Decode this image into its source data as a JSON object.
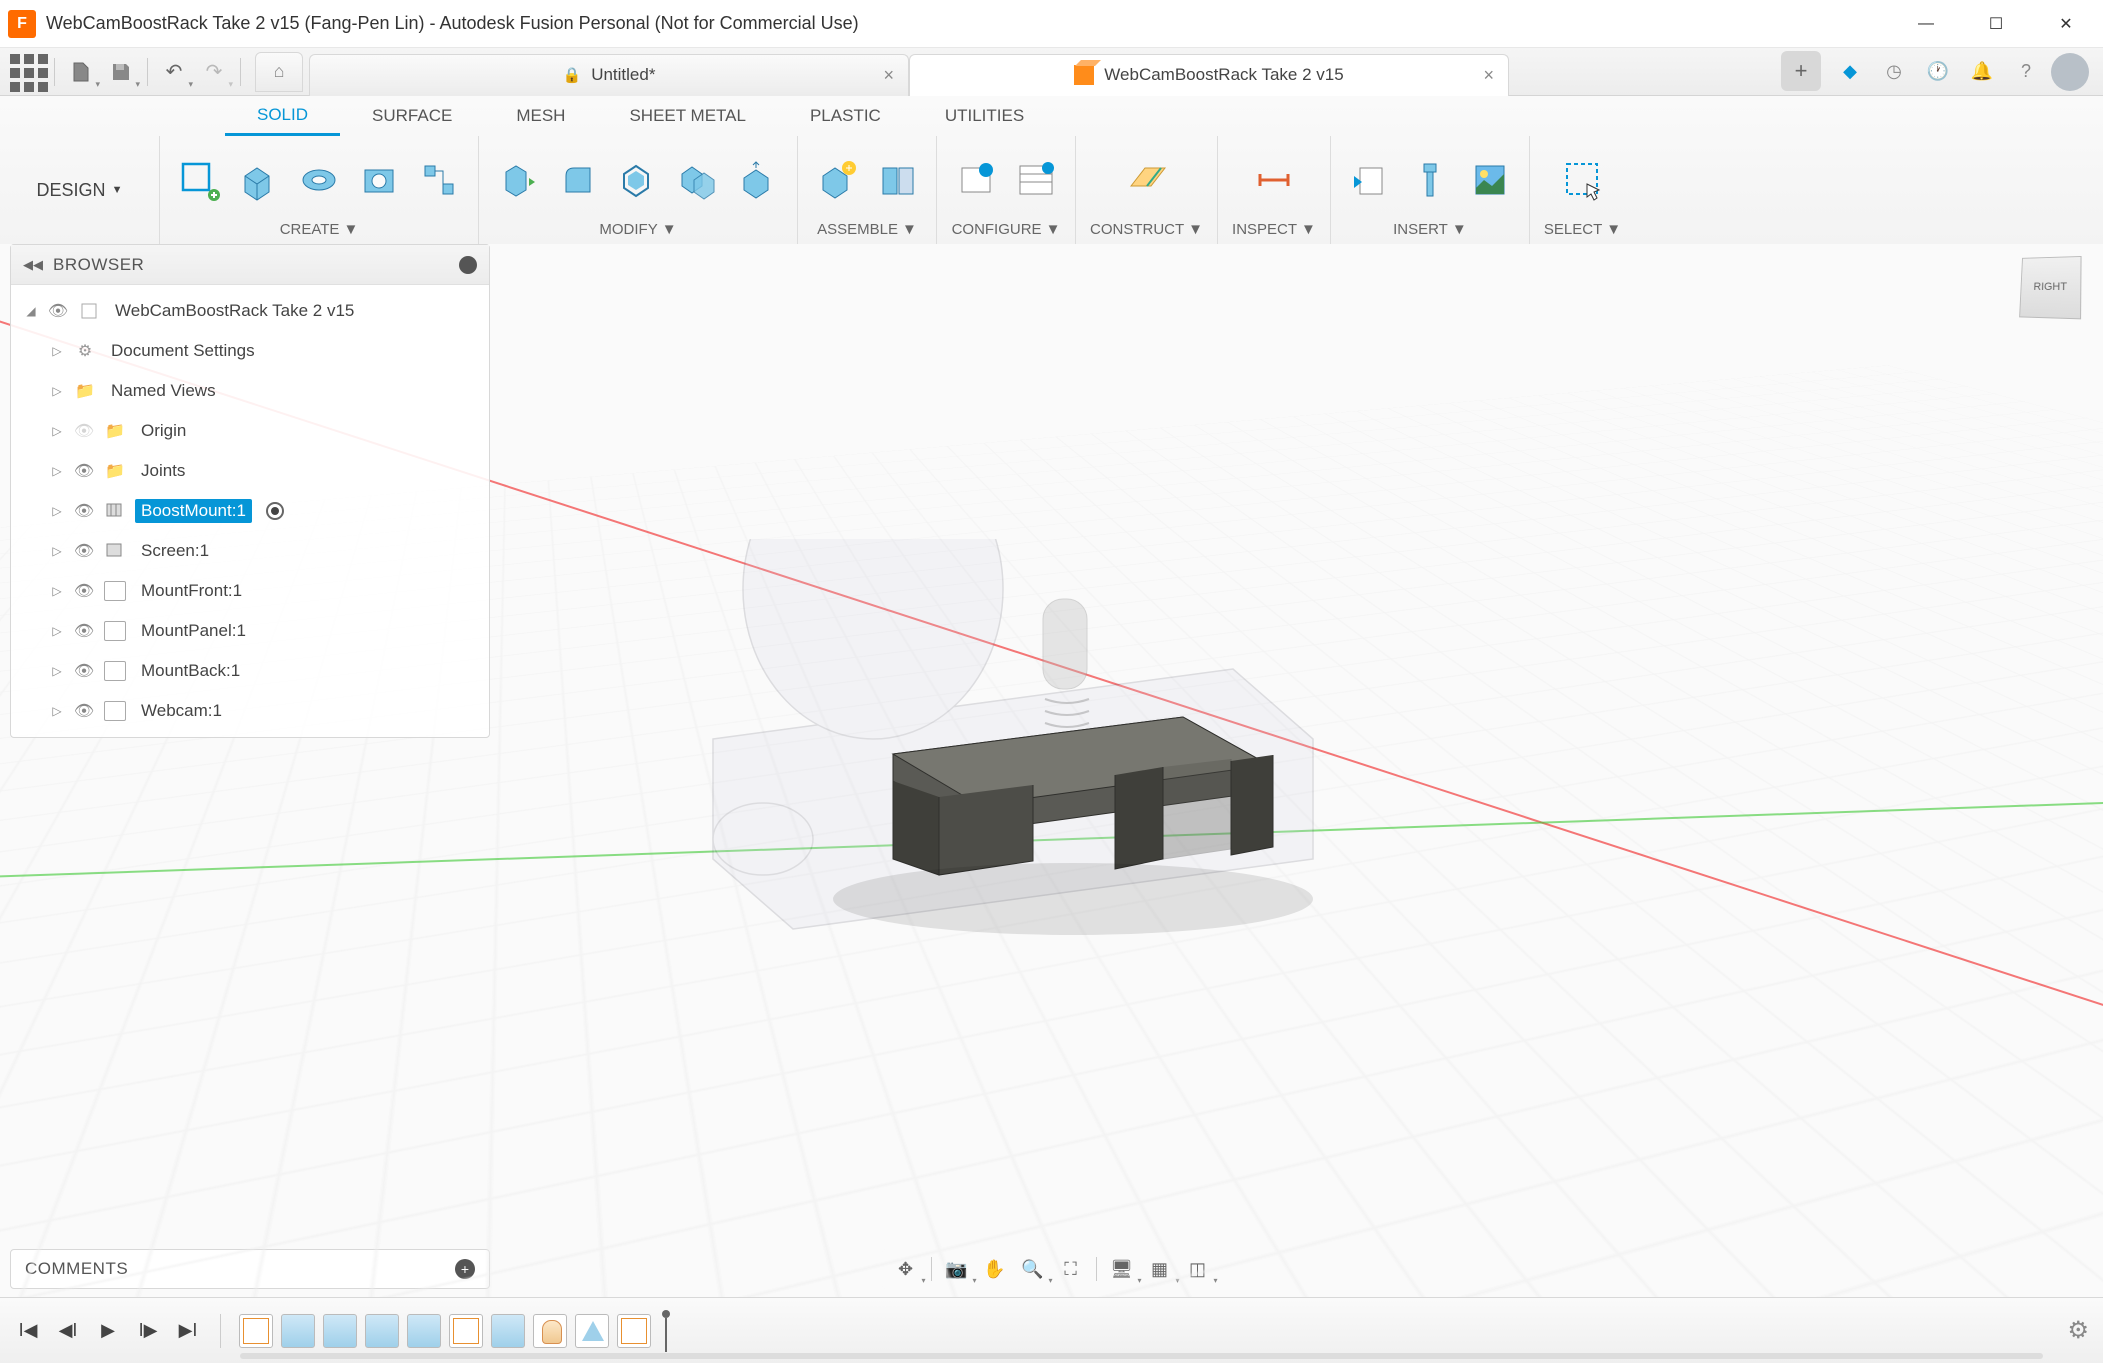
{
  "window": {
    "title": "WebCamBoostRack Take 2 v15 (Fang-Pen Lin) - Autodesk Fusion Personal (Not for Commercial Use)"
  },
  "tabs": {
    "inactive": "Untitled*",
    "active": "WebCamBoostRack Take 2 v15"
  },
  "workspace": "DESIGN",
  "ribbon_tabs": [
    "SOLID",
    "SURFACE",
    "MESH",
    "SHEET METAL",
    "PLASTIC",
    "UTILITIES"
  ],
  "ribbon_groups": {
    "create": "CREATE",
    "modify": "MODIFY",
    "assemble": "ASSEMBLE",
    "configure": "CONFIGURE",
    "construct": "CONSTRUCT",
    "inspect": "INSPECT",
    "insert": "INSERT",
    "select": "SELECT"
  },
  "browser": {
    "title": "BROWSER",
    "root": "WebCamBoostRack Take 2 v15",
    "items": [
      {
        "label": "Document Settings",
        "icon": "gear"
      },
      {
        "label": "Named Views",
        "icon": "folder"
      },
      {
        "label": "Origin",
        "icon": "folder",
        "hidden": true,
        "eye": true
      },
      {
        "label": "Joints",
        "icon": "folder",
        "eye": true
      },
      {
        "label": "BoostMount:1",
        "icon": "comp",
        "eye": true,
        "selected": true,
        "radio": true
      },
      {
        "label": "Screen:1",
        "icon": "comp",
        "eye": true
      },
      {
        "label": "MountFront:1",
        "icon": "body",
        "eye": true
      },
      {
        "label": "MountPanel:1",
        "icon": "body",
        "eye": true
      },
      {
        "label": "MountBack:1",
        "icon": "body",
        "eye": true
      },
      {
        "label": "Webcam:1",
        "icon": "body",
        "eye": true
      }
    ]
  },
  "comments": "COMMENTS",
  "viewcube": "RIGHT"
}
